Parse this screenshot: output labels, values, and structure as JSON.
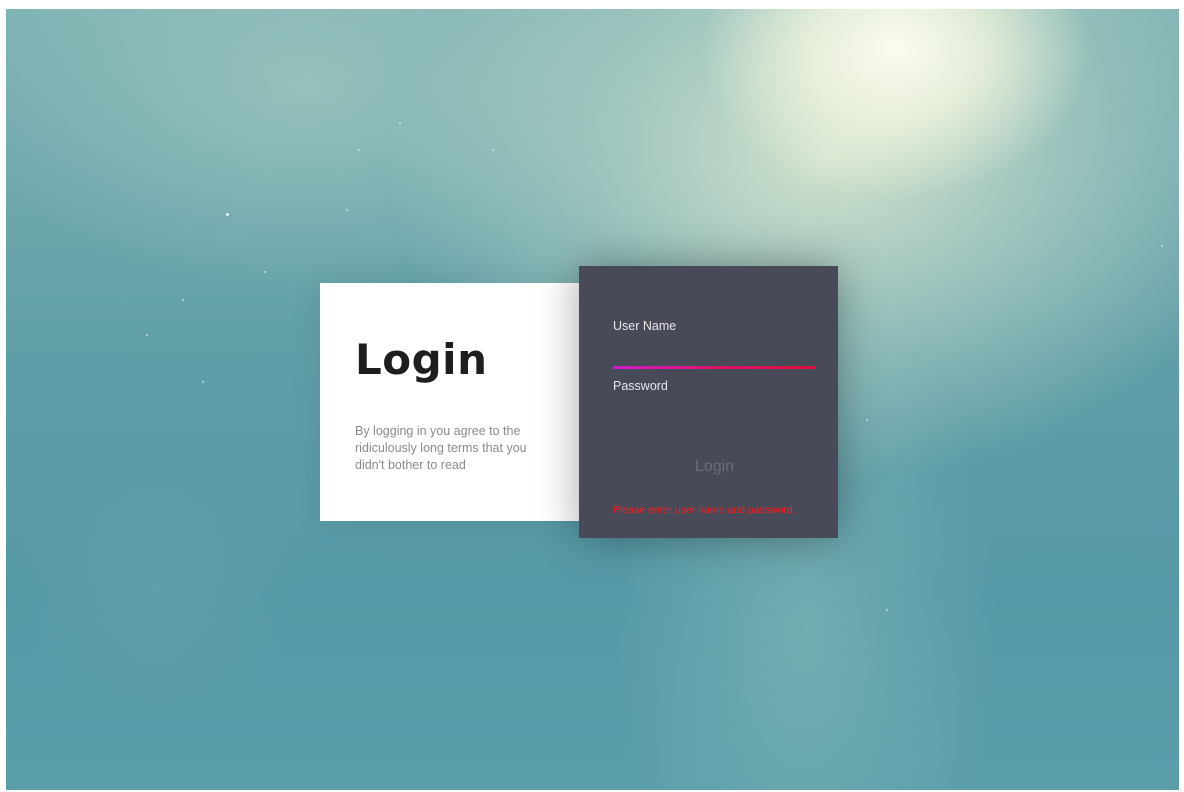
{
  "info_panel": {
    "title": "Login",
    "terms": "By logging in you agree to the ridiculously long terms that you didn't bother to read"
  },
  "login_form": {
    "username_label": "User Name",
    "username_value": "",
    "password_label": "Password",
    "password_value": "",
    "submit_label": "Login",
    "error_message": "Please enter user name and password."
  },
  "colors": {
    "form_background": "#484a58",
    "focus_gradient_start": "#d21ad1",
    "focus_gradient_end": "#de1038",
    "error": "#ff1a1a"
  }
}
